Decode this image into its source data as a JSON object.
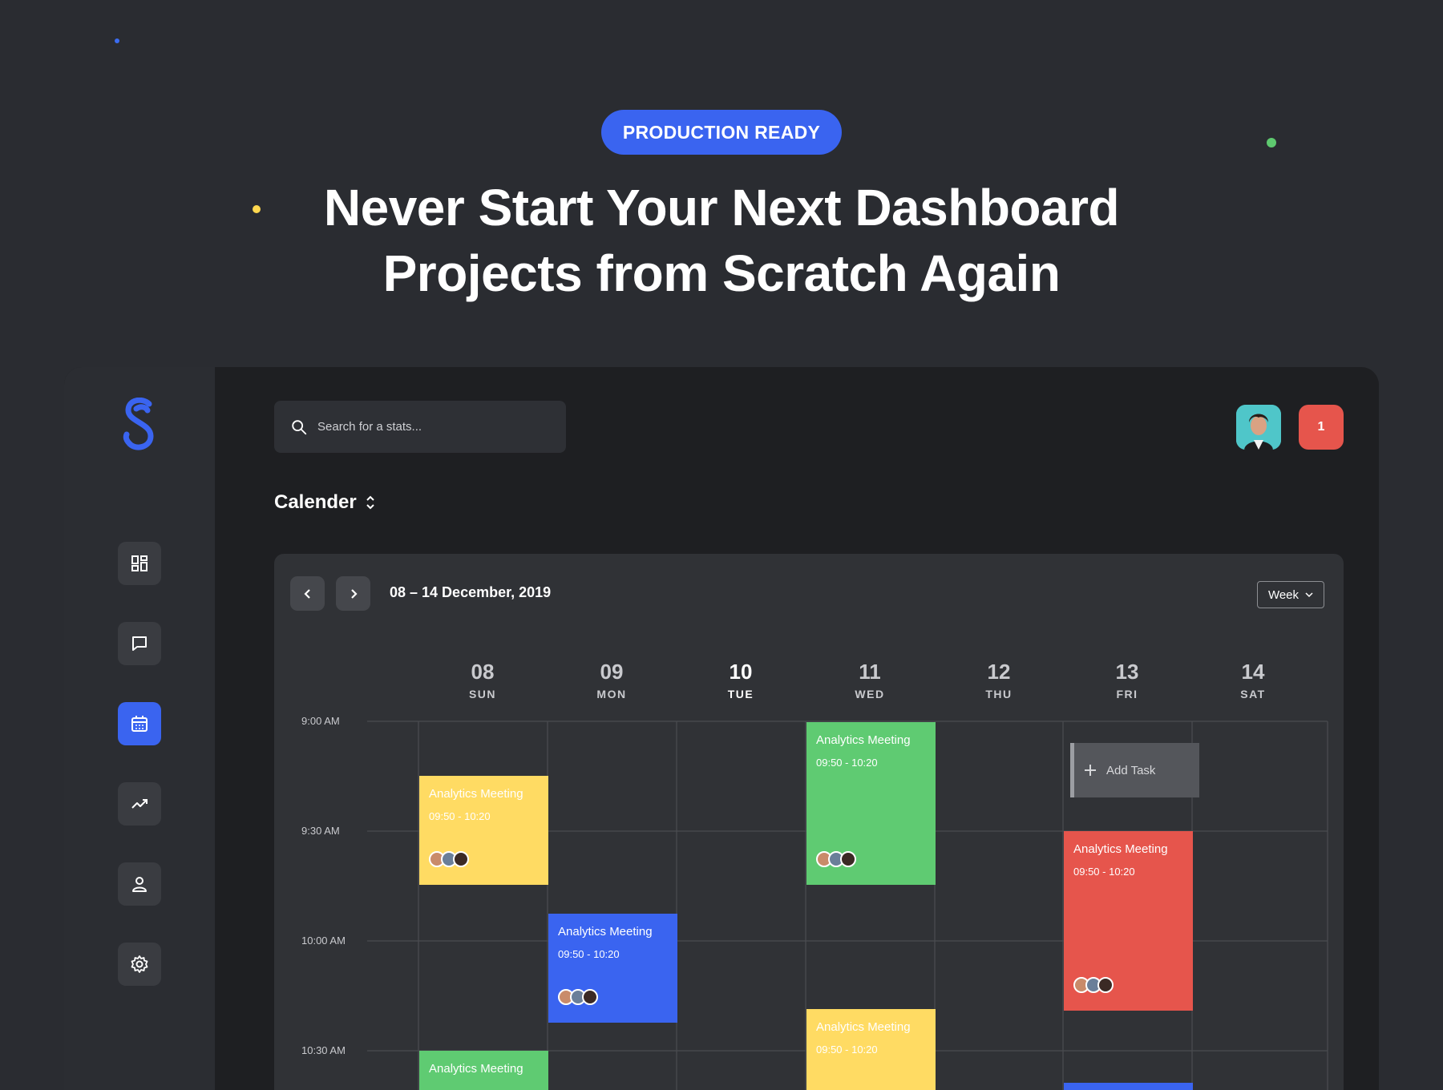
{
  "hero": {
    "badge": "PRODUCTION READY",
    "headline_line1": "Never Start Your Next Dashboard",
    "headline_line2": "Projects from Scratch Again"
  },
  "sidebar": {
    "logo": "s-logo",
    "items": [
      {
        "name": "dashboard",
        "icon": "grid-icon",
        "active": false
      },
      {
        "name": "messages",
        "icon": "chat-icon",
        "active": false
      },
      {
        "name": "calendar",
        "icon": "calendar-icon",
        "active": true
      },
      {
        "name": "analytics",
        "icon": "trend-icon",
        "active": false
      },
      {
        "name": "profile",
        "icon": "user-icon",
        "active": false
      },
      {
        "name": "settings",
        "icon": "gear-icon",
        "active": false
      }
    ]
  },
  "header": {
    "search_placeholder": "Search for a stats...",
    "notification_count": "1"
  },
  "calendar": {
    "title": "Calender",
    "range": "08 – 14 December, 2019",
    "view": "Week",
    "days": [
      {
        "num": "08",
        "weekday": "SUN"
      },
      {
        "num": "09",
        "weekday": "MON"
      },
      {
        "num": "10",
        "weekday": "TUE",
        "today": true
      },
      {
        "num": "11",
        "weekday": "WED"
      },
      {
        "num": "12",
        "weekday": "THU"
      },
      {
        "num": "13",
        "weekday": "FRI"
      },
      {
        "num": "14",
        "weekday": "SAT"
      }
    ],
    "times": [
      "9:00 AM",
      "9:30 AM",
      "10:00 AM",
      "10:30 AM"
    ],
    "add_task_label": "Add Task",
    "events": [
      {
        "title": "Analytics Meeting",
        "time": "09:50 - 10:20",
        "day": "SUN",
        "color": "#ffdb63"
      },
      {
        "title": "Analytics Meeting",
        "time": "09:50 - 10:20",
        "day": "MON",
        "color": "#3a64f0"
      },
      {
        "title": "Analytics Meeting",
        "time": "09:50 - 10:20",
        "day": "WED",
        "color": "#5fcb72"
      },
      {
        "title": "Analytics Meeting",
        "time": "09:50 - 10:20",
        "day": "WED",
        "color": "#ffdb63"
      },
      {
        "title": "Analytics Meeting",
        "time": "09:50 - 10:20",
        "day": "FRI",
        "color": "#e6554c"
      },
      {
        "title": "Analytics Meeting",
        "day": "SUN",
        "color": "#5fcb72"
      }
    ]
  },
  "colors": {
    "accent": "#3a64f0",
    "yellow": "#ffdb63",
    "green": "#5fcb72",
    "red": "#e6554c"
  }
}
